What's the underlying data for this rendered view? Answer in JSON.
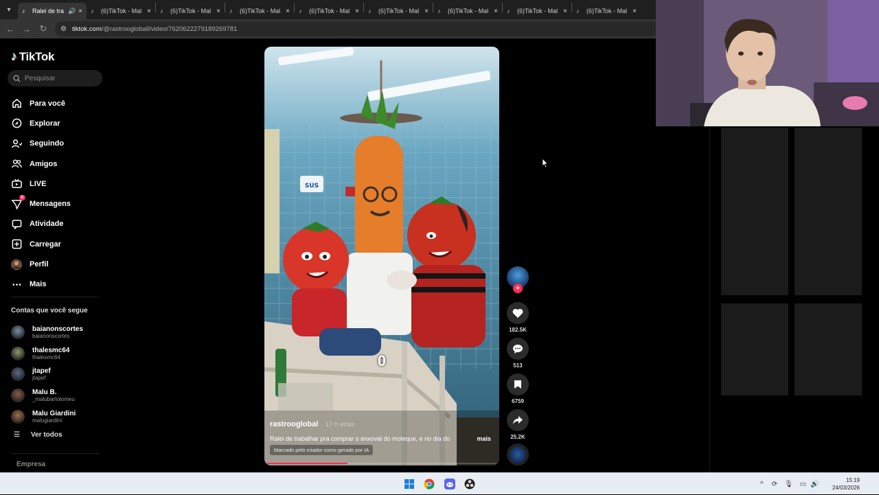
{
  "browser": {
    "tabs": [
      {
        "label": "Ralei de tra",
        "active": true,
        "audio": true
      },
      {
        "label": "(6)TikTok - Mal"
      },
      {
        "label": "(6)TikTok - Mal"
      },
      {
        "label": "(6)TikTok - Mal"
      },
      {
        "label": "(6)TikTok - Mal"
      },
      {
        "label": "(6)TikTok - Mal"
      },
      {
        "label": "(6)TikTok - Mal"
      },
      {
        "label": "(6)TikTok - Mal"
      },
      {
        "label": "(6)TikTok - Mal"
      }
    ],
    "url_host": "tiktok.com",
    "url_path": "/@rastroogloball/video/7620622279189269781"
  },
  "sidebar": {
    "brand": "TikTok",
    "search_placeholder": "Pesquisar",
    "nav": [
      {
        "label": "Para você",
        "icon": "home-icon"
      },
      {
        "label": "Explorar",
        "icon": "compass-icon"
      },
      {
        "label": "Seguindo",
        "icon": "user-follow-icon"
      },
      {
        "label": "Amigos",
        "icon": "friends-icon"
      },
      {
        "label": "LIVE",
        "icon": "live-tv-icon"
      },
      {
        "label": "Mensagens",
        "icon": "messages-icon",
        "badge": "6"
      },
      {
        "label": "Atividade",
        "icon": "activity-icon"
      },
      {
        "label": "Carregar",
        "icon": "upload-icon"
      },
      {
        "label": "Perfil",
        "icon": "profile-avatar"
      },
      {
        "label": "Mais",
        "icon": "more-icon"
      }
    ],
    "following_title": "Contas que você segue",
    "following": [
      {
        "name": "baianonscortes",
        "handle": "baianonscortes"
      },
      {
        "name": "thalesmc64",
        "handle": "thalesmc64"
      },
      {
        "name": "jtapef",
        "handle": "jtapef"
      },
      {
        "name": "Malu B.",
        "handle": "_malubartolomeu"
      },
      {
        "name": "Malu Giardini",
        "handle": "malugiardini"
      }
    ],
    "see_all": "Ver todos",
    "footer": "Empresa"
  },
  "video": {
    "counter": "0",
    "author": "rastrooglobal",
    "time": "· 17 h atrás",
    "caption": "Ralei de trabalhar pra comprar o enxoval do moleque, e no dia do",
    "more": "mais",
    "ai_label": "Marcado pelo criador como gerado por IA",
    "progress": 0.35
  },
  "actions": {
    "likes": "182.5K",
    "comments": "513",
    "saves": "6759",
    "shares": "25.2K"
  },
  "taskbar": {
    "time": "15:19",
    "date": "24/03/2026"
  },
  "colors": {
    "accent": "#fe2c55",
    "background": "#000000"
  }
}
